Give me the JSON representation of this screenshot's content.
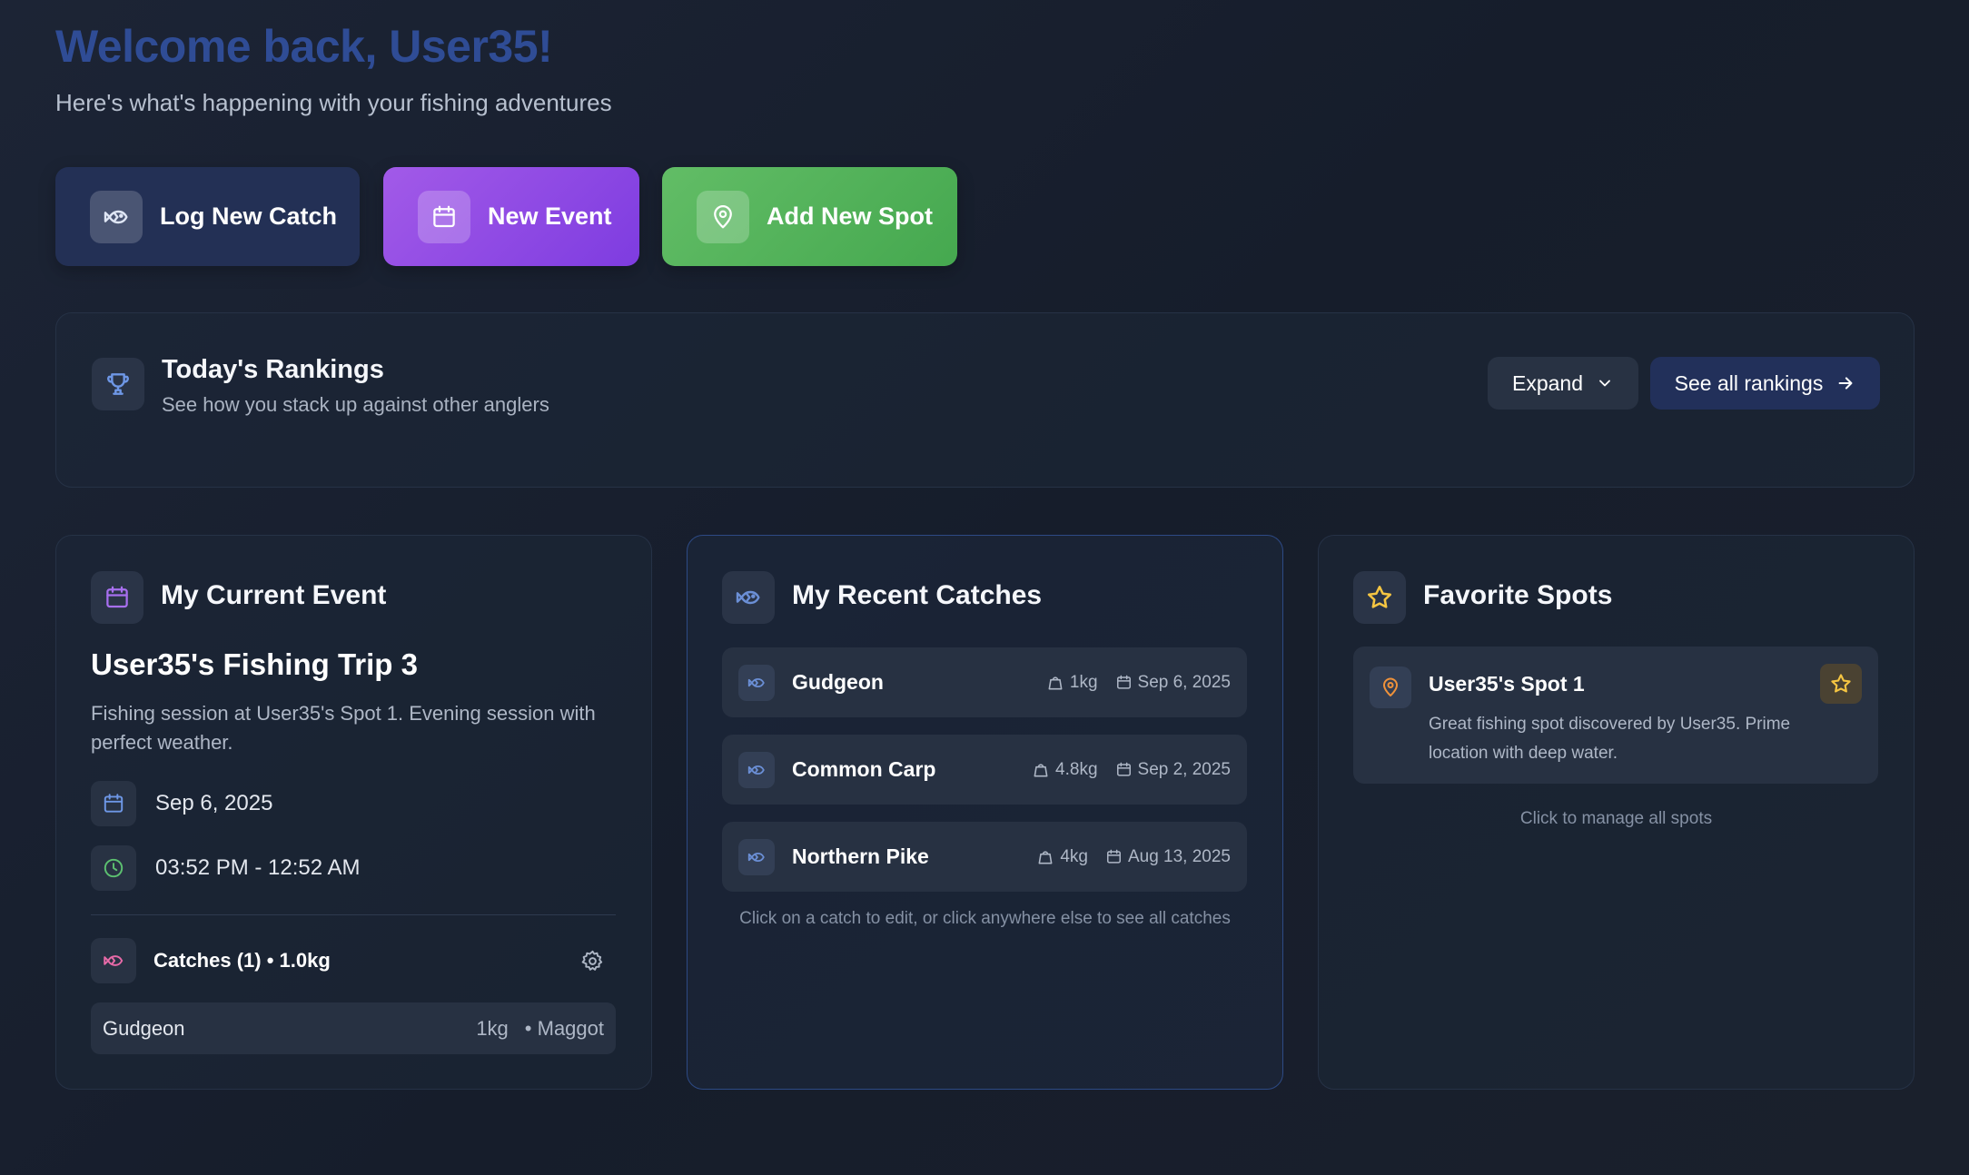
{
  "header": {
    "welcome": "Welcome back, User35!",
    "subtitle": "Here's what's happening with your fishing adventures"
  },
  "quick_actions": {
    "log_catch": "Log New Catch",
    "new_event": "New Event",
    "add_spot": "Add New Spot"
  },
  "rankings": {
    "title": "Today's Rankings",
    "subtitle": "See how you stack up against other anglers",
    "expand_label": "Expand",
    "see_all_label": "See all rankings"
  },
  "current_event": {
    "heading": "My Current Event",
    "title": "User35's Fishing Trip 3",
    "description": "Fishing session at User35's Spot 1. Evening session with perfect weather.",
    "date": "Sep 6, 2025",
    "time": "03:52 PM - 12:52 AM",
    "catches_summary": "Catches (1) • 1.0kg",
    "catches": [
      {
        "species": "Gudgeon",
        "weight": "1kg",
        "bait": "• Maggot"
      }
    ]
  },
  "recent_catches": {
    "heading": "My Recent Catches",
    "items": [
      {
        "species": "Gudgeon",
        "weight": "1kg",
        "date": "Sep 6, 2025"
      },
      {
        "species": "Common Carp",
        "weight": "4.8kg",
        "date": "Sep 2, 2025"
      },
      {
        "species": "Northern Pike",
        "weight": "4kg",
        "date": "Aug 13, 2025"
      }
    ],
    "hint": "Click on a catch to edit, or click anywhere else to see all catches"
  },
  "favorite_spots": {
    "heading": "Favorite Spots",
    "items": [
      {
        "name": "User35's Spot 1",
        "description": "Great fishing spot discovered by User35. Prime location with deep water."
      }
    ],
    "hint": "Click to manage all spots"
  },
  "colors": {
    "welcome": "#2f4c95",
    "event_purple": "#a25ae8",
    "spot_green": "#62bd66",
    "star_yellow": "#f5c542",
    "catch_blue": "#6b8fd6"
  },
  "icons": [
    "fish-icon",
    "calendar-icon",
    "map-pin-icon",
    "trophy-icon",
    "chevron-down-icon",
    "arrow-right-icon",
    "star-icon",
    "clock-icon",
    "gear-icon",
    "weight-icon"
  ]
}
